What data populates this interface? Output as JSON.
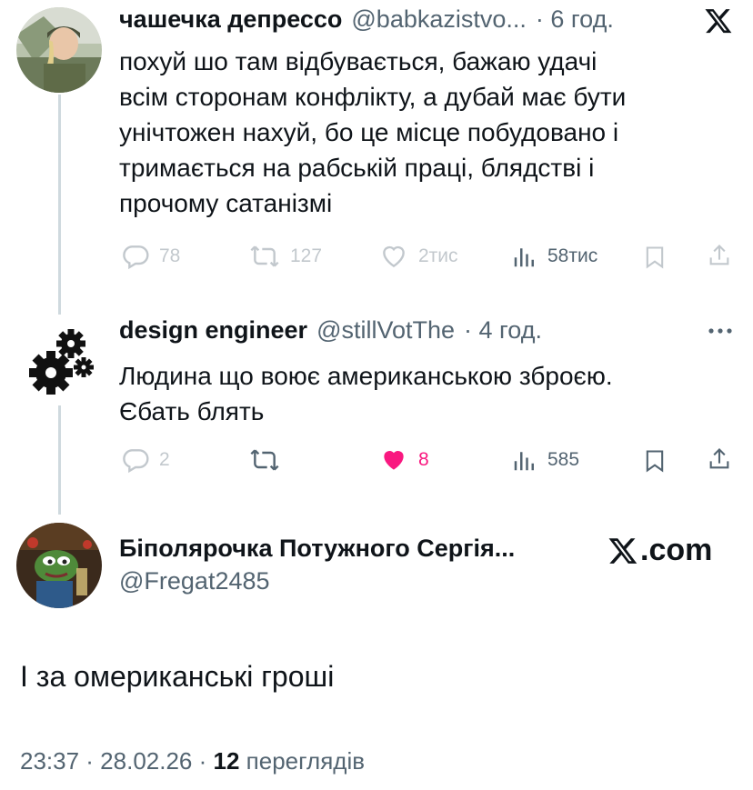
{
  "tweets": [
    {
      "author": "чашечка депрессо",
      "handle": "@babkazistvo...",
      "time": "· 6 год.",
      "text_lines": [
        "похуй шо там відбувається, бажаю удачі",
        "всім сторонам конфлікту, а дубай має бути",
        "унічтожен нахуй, бо це місце побудовано і",
        "тримається на рабській праці, блядстві і",
        "прочому сатанізмі"
      ],
      "stats": {
        "replies": "78",
        "reposts": "127",
        "likes": "2тис",
        "views": "58тис"
      }
    },
    {
      "author": "design engineer",
      "handle": "@stillVotThe",
      "time": "· 4 год.",
      "text_lines": [
        "Людина що воює американською зброєю.",
        "Єбать блять"
      ],
      "stats": {
        "replies": "2",
        "reposts": "",
        "likes": "8",
        "views": "585"
      }
    }
  ],
  "main_post": {
    "author": "Біполярочка Потужного Сергія...",
    "handle": "@Fregat2485",
    "brand": "X.com",
    "text": "І за омериканські гроші",
    "footer": {
      "time": "23:37 · 28.02.26 ·",
      "views_count": "12",
      "views_label": "переглядів"
    }
  },
  "colors": {
    "text": "#0f1419",
    "secondary": "#536471",
    "like_active": "#f91880",
    "thread_line": "#cfd9de"
  }
}
